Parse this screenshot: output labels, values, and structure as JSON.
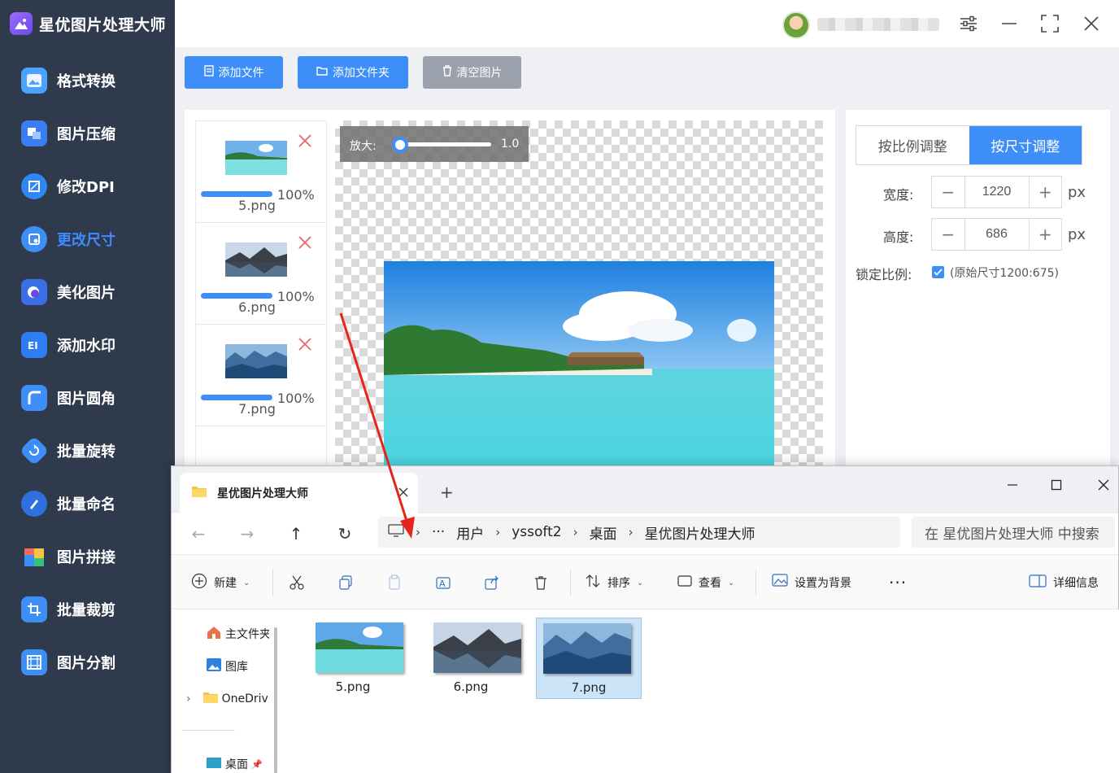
{
  "app": {
    "title": "星优图片处理大师",
    "username": ""
  },
  "sidebar": {
    "items": [
      {
        "label": "格式转换",
        "icon": "image-convert-icon"
      },
      {
        "label": "图片压缩",
        "icon": "image-compress-icon"
      },
      {
        "label": "修改DPI",
        "icon": "dpi-icon"
      },
      {
        "label": "更改尺寸",
        "icon": "resize-icon",
        "active": true
      },
      {
        "label": "美化图片",
        "icon": "beautify-icon"
      },
      {
        "label": "添加水印",
        "icon": "watermark-icon"
      },
      {
        "label": "图片圆角",
        "icon": "round-corner-icon"
      },
      {
        "label": "批量旋转",
        "icon": "rotate-icon"
      },
      {
        "label": "批量命名",
        "icon": "rename-icon"
      },
      {
        "label": "图片拼接",
        "icon": "puzzle-icon"
      },
      {
        "label": "批量裁剪",
        "icon": "crop-icon"
      },
      {
        "label": "图片分割",
        "icon": "split-icon"
      }
    ]
  },
  "toolbar": {
    "add_file": "添加文件",
    "add_folder": "添加文件夹",
    "clear": "清空图片"
  },
  "file_list": [
    {
      "name": "5.png",
      "progress": "100%",
      "progress_value": 1.0
    },
    {
      "name": "6.png",
      "progress": "100%",
      "progress_value": 1.0
    },
    {
      "name": "7.png",
      "progress": "100%",
      "progress_value": 1.0
    }
  ],
  "preview": {
    "zoom_label": "放大:",
    "zoom_value": "1.0"
  },
  "settings": {
    "tab_ratio": "按比例调整",
    "tab_size": "按尺寸调整",
    "width_label": "宽度:",
    "width_value": "1220",
    "height_label": "高度:",
    "height_value": "686",
    "unit": "px",
    "lock_label": "锁定比例:",
    "lock_note": "(原始尺寸1200:675)",
    "lock_checked": true
  },
  "explorer": {
    "tab_title": "星优图片处理大师",
    "breadcrumb": [
      "用户",
      "yssoft2",
      "桌面",
      "星优图片处理大师"
    ],
    "search_placeholder": "在 星优图片处理大师 中搜索",
    "commands": {
      "new": "新建",
      "sort": "排序",
      "view": "查看",
      "set_background": "设置为背景",
      "details": "详细信息"
    },
    "nav_pane": [
      "主文件夹",
      "图库",
      "OneDrive",
      "桌面"
    ],
    "files": [
      {
        "name": "5.png",
        "selected": false
      },
      {
        "name": "6.png",
        "selected": false
      },
      {
        "name": "7.png",
        "selected": true
      }
    ]
  },
  "colors": {
    "accent": "#3e8ef7",
    "sidebar_bg": "#2f3a4d",
    "annotation_arrow": "#e8231a"
  }
}
